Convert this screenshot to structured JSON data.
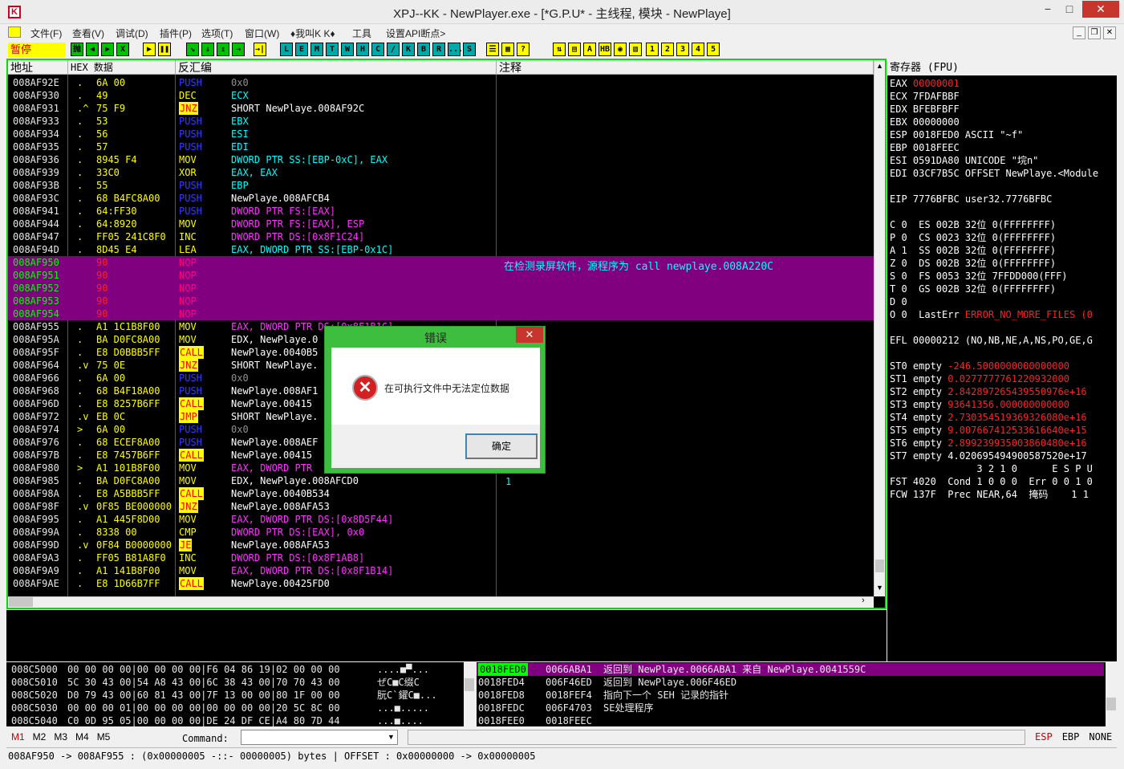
{
  "window": {
    "title": "XPJ--KK - NewPlayer.exe - [*G.P.U* -  主线程, 模块 - NewPlaye]",
    "icon_letter": "K",
    "minimize": "−",
    "maximize": "□",
    "close": "✕"
  },
  "menu": [
    "文件(F)",
    "查看(V)",
    "调试(D)",
    "插件(P)",
    "选项(T)",
    "窗口(W)",
    "♦我叫K K♦",
    "工具",
    "设置API断点>"
  ],
  "mdi": {
    "min": "_",
    "restore": "❐",
    "close": "✕"
  },
  "toolbar": {
    "pause_label": "暂停",
    "group1": [
      "抛",
      "◀",
      "▶",
      "X"
    ],
    "group2": [
      "▶",
      "❚❚"
    ],
    "group3": [
      "↘",
      "↓",
      "↥",
      "→"
    ],
    "group4": [
      "→|"
    ],
    "letters": [
      "L",
      "E",
      "M",
      "T",
      "W",
      "H",
      "C",
      "/",
      "K",
      "B",
      "R",
      "...",
      "S"
    ],
    "group5": [
      "☰",
      "▦",
      "?"
    ],
    "group6": [
      "⇅",
      "▤",
      "A",
      "HB",
      "◉",
      "▧"
    ],
    "numbers": [
      "1",
      "2",
      "3",
      "4",
      "5"
    ]
  },
  "cpu": {
    "headers": {
      "addr": "地址",
      "hex": "HEX 数据",
      "disasm": "反汇编",
      "comment": "注释"
    },
    "rows": [
      {
        "addr": "008AF92E",
        "m": ".",
        "hex": "6A 00",
        "mn": "PUSH",
        "ops": "0x0",
        "k": "push",
        "oc": "gray"
      },
      {
        "addr": "008AF930",
        "m": ".",
        "hex": "49",
        "mn": "DEC",
        "ops": "ECX",
        "k": "y",
        "oc": "cyan"
      },
      {
        "addr": "008AF931",
        "m": ".^",
        "hex": "75 F9",
        "mn": "JNZ",
        "ops": "SHORT NewPlaye.008AF92C",
        "k": "jmp",
        "oc": "w"
      },
      {
        "addr": "008AF933",
        "m": ".",
        "hex": "53",
        "mn": "PUSH",
        "ops": "EBX",
        "k": "push",
        "oc": "cyan"
      },
      {
        "addr": "008AF934",
        "m": ".",
        "hex": "56",
        "mn": "PUSH",
        "ops": "ESI",
        "k": "push",
        "oc": "cyan"
      },
      {
        "addr": "008AF935",
        "m": ".",
        "hex": "57",
        "mn": "PUSH",
        "ops": "EDI",
        "k": "push",
        "oc": "cyan"
      },
      {
        "addr": "008AF936",
        "m": ".",
        "hex": "8945 F4",
        "mn": "MOV",
        "ops": "DWORD PTR SS:[EBP-0xC], EAX",
        "k": "y",
        "oc": "cyan"
      },
      {
        "addr": "008AF939",
        "m": ".",
        "hex": "33C0",
        "mn": "XOR",
        "ops": "EAX, EAX",
        "k": "y",
        "oc": "cyan"
      },
      {
        "addr": "008AF93B",
        "m": ".",
        "hex": "55",
        "mn": "PUSH",
        "ops": "EBP",
        "k": "push",
        "oc": "cyan"
      },
      {
        "addr": "008AF93C",
        "m": ".",
        "hex": "68 B4FC8A00",
        "mn": "PUSH",
        "ops": "NewPlaye.008AFCB4",
        "k": "push",
        "oc": "w"
      },
      {
        "addr": "008AF941",
        "m": ".",
        "hex": "64:FF30",
        "mn": "PUSH",
        "ops": "DWORD PTR FS:[EAX]",
        "k": "push",
        "oc": "mag"
      },
      {
        "addr": "008AF944",
        "m": ".",
        "hex": "64:8920",
        "mn": "MOV",
        "ops": "DWORD PTR FS:[EAX], ESP",
        "k": "y",
        "oc": "mag"
      },
      {
        "addr": "008AF947",
        "m": ".",
        "hex": "FF05 241C8F0",
        "mn": "INC",
        "ops": "DWORD PTR DS:[0x8F1C24]",
        "k": "y",
        "oc": "mag"
      },
      {
        "addr": "008AF94D",
        "m": ".",
        "hex": "8D45 E4",
        "mn": "LEA",
        "ops": "EAX, DWORD PTR SS:[EBP-0x1C]",
        "k": "y",
        "oc": "cyan"
      },
      {
        "addr": "008AF950",
        "m": "",
        "hex": "90",
        "mn": "NOP",
        "ops": "",
        "k": "nop",
        "oc": "w",
        "sel": true
      },
      {
        "addr": "008AF951",
        "m": "",
        "hex": "90",
        "mn": "NOP",
        "ops": "",
        "k": "nop",
        "oc": "w",
        "sel": true
      },
      {
        "addr": "008AF952",
        "m": "",
        "hex": "90",
        "mn": "NOP",
        "ops": "",
        "k": "nop",
        "oc": "w",
        "sel": true
      },
      {
        "addr": "008AF953",
        "m": "",
        "hex": "90",
        "mn": "NOP",
        "ops": "",
        "k": "nop",
        "oc": "w",
        "sel": true
      },
      {
        "addr": "008AF954",
        "m": "",
        "hex": "90",
        "mn": "NOP",
        "ops": "",
        "k": "nop",
        "oc": "w",
        "sel": true
      },
      {
        "addr": "008AF955",
        "m": ".",
        "hex": "A1 1C1B8F00",
        "mn": "MOV",
        "ops": "EAX, DWORD PTR DS:[0x8F1B1C]",
        "k": "y",
        "oc": "mag"
      },
      {
        "addr": "008AF95A",
        "m": ".",
        "hex": "BA D0FC8A00",
        "mn": "MOV",
        "ops": "EDX, NewPlaye.0",
        "k": "y",
        "oc": "w"
      },
      {
        "addr": "008AF95F",
        "m": ".",
        "hex": "E8 D0BBB5FF",
        "mn": "CALL",
        "ops": "NewPlaye.0040B5",
        "k": "call",
        "oc": "w"
      },
      {
        "addr": "008AF964",
        "m": ".v",
        "hex": "75 0E",
        "mn": "JNZ",
        "ops": "SHORT NewPlaye.",
        "k": "jmp",
        "oc": "w"
      },
      {
        "addr": "008AF966",
        "m": ".",
        "hex": "6A 00",
        "mn": "PUSH",
        "ops": "0x0",
        "k": "push",
        "oc": "gray"
      },
      {
        "addr": "008AF968",
        "m": ".",
        "hex": "68 B4F18A00",
        "mn": "PUSH",
        "ops": "NewPlaye.008AF1",
        "k": "push",
        "oc": "w"
      },
      {
        "addr": "008AF96D",
        "m": ".",
        "hex": "E8 8257B6FF",
        "mn": "CALL",
        "ops": "NewPlaye.00415",
        "k": "call",
        "oc": "w"
      },
      {
        "addr": "008AF972",
        "m": ".v",
        "hex": "EB 0C",
        "mn": "JMP",
        "ops": "SHORT NewPlaye.",
        "k": "jmp",
        "oc": "w"
      },
      {
        "addr": "008AF974",
        "m": ">",
        "hex": "6A 00",
        "mn": "PUSH",
        "ops": "0x0",
        "k": "push",
        "oc": "gray"
      },
      {
        "addr": "008AF976",
        "m": ".",
        "hex": "68 ECEF8A00",
        "mn": "PUSH",
        "ops": "NewPlaye.008AEF",
        "k": "push",
        "oc": "w"
      },
      {
        "addr": "008AF97B",
        "m": ".",
        "hex": "E8 7457B6FF",
        "mn": "CALL",
        "ops": "NewPlaye.00415",
        "k": "call",
        "oc": "w"
      },
      {
        "addr": "008AF980",
        "m": ">",
        "hex": "A1 101B8F00",
        "mn": "MOV",
        "ops": "EAX, DWORD PTR",
        "k": "y",
        "oc": "mag"
      },
      {
        "addr": "008AF985",
        "m": ".",
        "hex": "BA D0FC8A00",
        "mn": "MOV",
        "ops": "EDX, NewPlaye.008AFCD0",
        "k": "y",
        "oc": "w"
      },
      {
        "addr": "008AF98A",
        "m": ".",
        "hex": "E8 A5BBB5FF",
        "mn": "CALL",
        "ops": "NewPlaye.0040B534",
        "k": "call",
        "oc": "w"
      },
      {
        "addr": "008AF98F",
        "m": ".v",
        "hex": "0F85 BE000000",
        "mn": "JNZ",
        "ops": "NewPlaye.008AFA53",
        "k": "jmp",
        "oc": "w"
      },
      {
        "addr": "008AF995",
        "m": ".",
        "hex": "A1 445F8D00",
        "mn": "MOV",
        "ops": "EAX, DWORD PTR DS:[0x8D5F44]",
        "k": "y",
        "oc": "mag"
      },
      {
        "addr": "008AF99A",
        "m": ".",
        "hex": "8338 00",
        "mn": "CMP",
        "ops": "DWORD PTR DS:[EAX], 0x0",
        "k": "y",
        "oc": "mag"
      },
      {
        "addr": "008AF99D",
        "m": ".v",
        "hex": "0F84 B0000000",
        "mn": "JE",
        "ops": "NewPlaye.008AFA53",
        "k": "jmp",
        "oc": "w"
      },
      {
        "addr": "008AF9A3",
        "m": ".",
        "hex": "FF05 B81A8F0",
        "mn": "INC",
        "ops": "DWORD PTR DS:[0x8F1AB8]",
        "k": "y",
        "oc": "mag"
      },
      {
        "addr": "008AF9A9",
        "m": ".",
        "hex": "A1 141B8F00",
        "mn": "MOV",
        "ops": "EAX, DWORD PTR DS:[0x8F1B14]",
        "k": "y",
        "oc": "mag"
      },
      {
        "addr": "008AF9AE",
        "m": ".",
        "hex": "E8 1D66B7FF",
        "mn": "CALL",
        "ops": "NewPlaye.00425FD0",
        "k": "call",
        "oc": "w"
      }
    ],
    "comment_sel": "在检测录屏软件，源程序为 call newplaye.008A220C",
    "comment_one": "1"
  },
  "regs": {
    "title": "寄存器 (FPU)",
    "lines": [
      {
        "t": "EAX ",
        "v": "00000001",
        "vc": "red"
      },
      {
        "t": "ECX 7FDAFBBF"
      },
      {
        "t": "EDX BFEBFBFF"
      },
      {
        "t": "EBX 00000000"
      },
      {
        "t": "ESP 0018FED0 ASCII \"~f\""
      },
      {
        "t": "EBP 0018FEEC"
      },
      {
        "t": "ESI 0591DA80 UNICODE \"垸n\""
      },
      {
        "t": "EDI 03CF7B5C OFFSET NewPlaye.<Module"
      },
      {
        "t": ""
      },
      {
        "t": "EIP 7776BFBC user32.7776BFBC"
      },
      {
        "t": ""
      },
      {
        "t": "C 0  ES 002B 32位 0(FFFFFFFF)"
      },
      {
        "t": "P 0  CS 0023 32位 0(FFFFFFFF)"
      },
      {
        "t": "A 1  SS 002B 32位 0(FFFFFFFF)"
      },
      {
        "t": "Z 0  DS 002B 32位 0(FFFFFFFF)"
      },
      {
        "t": "S 0  FS 0053 32位 7FFDD000(FFF)"
      },
      {
        "t": "T 0  GS 002B 32位 0(FFFFFFFF)"
      },
      {
        "t": "D 0"
      },
      {
        "t": "O 0  LastErr ",
        "v": "ERROR_NO_MORE_FILES (0",
        "vc": "red"
      },
      {
        "t": ""
      },
      {
        "t": "EFL 00000212 (NO,NB,NE,A,NS,PO,GE,G"
      },
      {
        "t": ""
      },
      {
        "t": "ST0 empty ",
        "v": "-246.5000000000000000",
        "vc": "red"
      },
      {
        "t": "ST1 empty ",
        "v": "0.0277777761220932000",
        "vc": "red"
      },
      {
        "t": "ST2 empty ",
        "v": "2.842897265439550976e+16",
        "vc": "red"
      },
      {
        "t": "ST3 empty ",
        "v": "93641356.000000000000",
        "vc": "red"
      },
      {
        "t": "ST4 empty ",
        "v": "2.730354519369326080e+16",
        "vc": "red"
      },
      {
        "t": "ST5 empty ",
        "v": "9.007667412533616640e+15",
        "vc": "red"
      },
      {
        "t": "ST6 empty ",
        "v": "2.899239935003860480e+16",
        "vc": "red"
      },
      {
        "t": "ST7 empty 4.020695494900587520e+17"
      },
      {
        "t": "               3 2 1 0      E S P U"
      },
      {
        "t": "FST 4020  Cond 1 0 0 0  Err 0 0 1 0"
      },
      {
        "t": "FCW 137F  Prec NEAR,64  掩码    1 1"
      }
    ]
  },
  "dump": {
    "rows": [
      {
        "addr": "008C5000",
        "hex": "00 00 00 00|00 00 00 00|F6 04 86 19|02 00 00 00",
        "asc": "....■▀..."
      },
      {
        "addr": "008C5010",
        "hex": "5C 30 43 00|54 A8 43 00|6C 38 43 00|70 70 43 00",
        "asc": "ぜC■C缀C"
      },
      {
        "addr": "008C5020",
        "hex": "D0 79 43 00|60 81 43 00|7F 13 00 00|80 1F 00 00",
        "asc": "朊C`鑃C■..."
      },
      {
        "addr": "008C5030",
        "hex": "00 00 00 01|00 00 00 00|00 00 00 00|20 5C 8C 00",
        "asc": "...■..... 尡."
      },
      {
        "addr": "008C5040",
        "hex": "C0 0D 95 05|00 00 00 00|DE 24 DF CE|A4 80 7D 44",
        "asc": "...■...."
      }
    ]
  },
  "stack": {
    "rows": [
      {
        "addr": "0018FED0",
        "val": "0066ABA1",
        "cmt": "返回到 NewPlaye.0066ABA1 来自 NewPlaye.0041559C",
        "sel": true
      },
      {
        "addr": "0018FED4",
        "val": "006F46ED",
        "cmt": "返回到 NewPlaye.006F46ED"
      },
      {
        "addr": "0018FED8",
        "val": "0018FEF4",
        "cmt": "指向下一个 SEH 记录的指针"
      },
      {
        "addr": "0018FEDC",
        "val": "006F4703",
        "cmt": "SE处理程序"
      },
      {
        "addr": "0018FEE0",
        "val": "0018FEEC",
        "cmt": ""
      }
    ]
  },
  "bottom": {
    "marks": [
      "M1",
      "M2",
      "M3",
      "M4",
      "M5"
    ],
    "command_label": "Command:",
    "command_value": "",
    "regs_right": [
      "ESP",
      "EBP",
      "NONE"
    ]
  },
  "status": {
    "text": "008AF950 -> 008AF955 :  (0x00000005  -::-   00000005) bytes   |   OFFSET : 0x00000000 -> 0x00000005"
  },
  "dialog": {
    "title": "错误",
    "close": "✕",
    "message": "在可执行文件中无法定位数据",
    "ok": "确定",
    "icon": "✕"
  },
  "colors": {
    "selection": "#800080",
    "frame": "#00e000",
    "pause_bg": "#ffff00"
  }
}
